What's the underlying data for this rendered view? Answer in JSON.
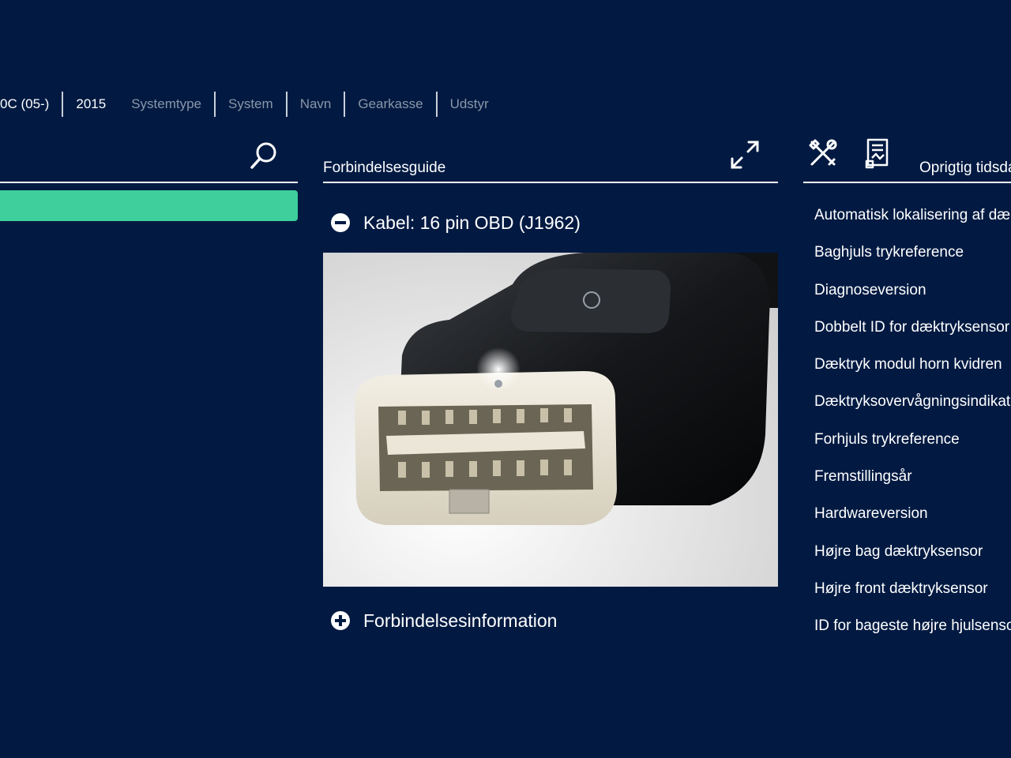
{
  "breadcrumb": {
    "items": [
      {
        "label": "0C (05-)",
        "active": true
      },
      {
        "label": "2015",
        "active": true
      },
      {
        "label": "Systemtype",
        "active": false
      },
      {
        "label": "System",
        "active": false
      },
      {
        "label": "Navn",
        "active": false
      },
      {
        "label": "Gearkasse",
        "active": false
      },
      {
        "label": "Udstyr",
        "active": false
      }
    ]
  },
  "left": {
    "search_icon": "search-icon",
    "selection_color": "#3ecf9d"
  },
  "middle": {
    "title": "Forbindelsesguide",
    "cable_label": "Kabel: 16 pin OBD (J1962)",
    "connection_info_label": "Forbindelsesinformation"
  },
  "right": {
    "title": "Oprigtig tidsdata",
    "items": [
      "Automatisk lokalisering af dæktryksensor",
      "Baghjuls trykreference",
      "Diagnoseversion",
      "Dobbelt ID for dæktryksensor",
      "Dæktryk modul horn kvidren",
      "Dæktryksovervågningsindikator",
      "Forhjuls trykreference",
      "Fremstillingsår",
      "Hardwareversion",
      "Højre bag dæktryksensor",
      "Højre front dæktryksensor",
      "ID for bageste højre hjulsensor"
    ]
  },
  "colors": {
    "background": "#021a42",
    "accent": "#3ecf9d",
    "text": "#ffffff",
    "muted": "#8a96a8"
  }
}
